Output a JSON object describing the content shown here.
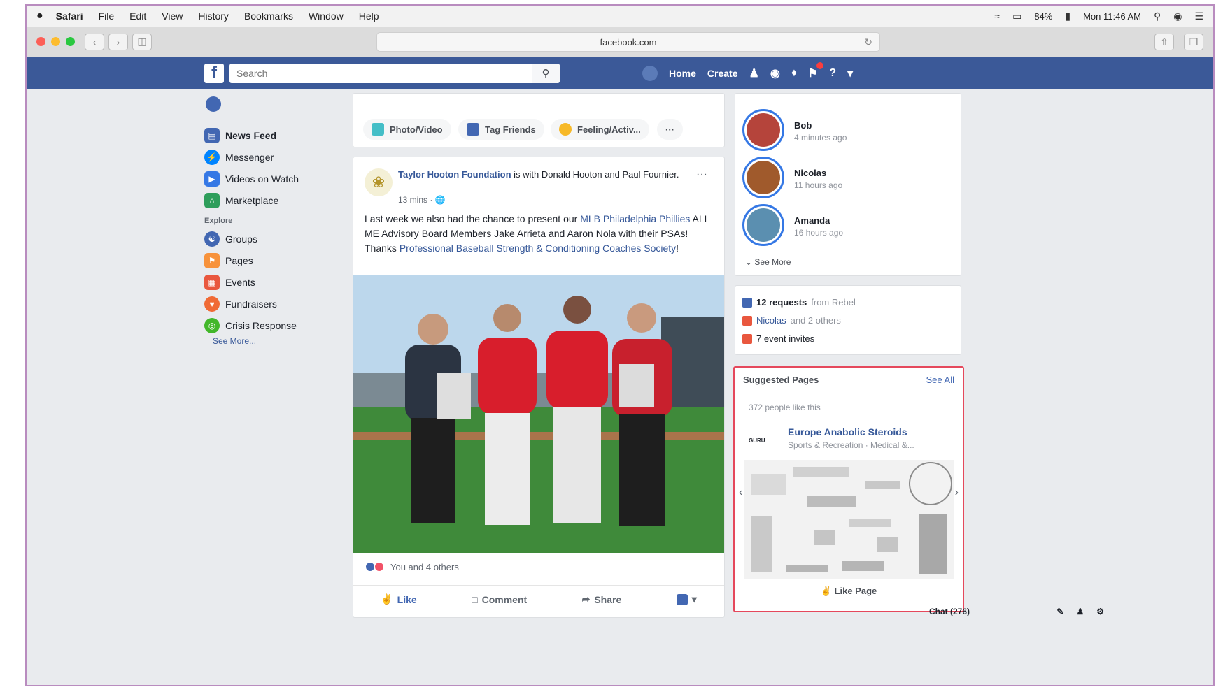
{
  "menubar": {
    "app": "Safari",
    "items": [
      "File",
      "Edit",
      "View",
      "History",
      "Bookmarks",
      "Window",
      "Help"
    ],
    "battery": "84%",
    "clock": "Mon 11:46 AM"
  },
  "browser": {
    "url": "facebook.com"
  },
  "fb": {
    "logo": "f",
    "search_placeholder": "Search",
    "nav_home": "Home",
    "nav_create": "Create"
  },
  "sidebar": {
    "items": [
      {
        "label": "News Feed",
        "icon": "news-feed-icon",
        "color": "#4267b2"
      },
      {
        "label": "Messenger",
        "icon": "messenger-icon",
        "color": "#0084ff"
      },
      {
        "label": "Videos on Watch",
        "icon": "watch-icon",
        "color": "#3578e5"
      },
      {
        "label": "Marketplace",
        "icon": "marketplace-icon",
        "color": "#2e9e5b"
      }
    ],
    "explore_header": "Explore",
    "explore": [
      {
        "label": "Groups",
        "icon": "groups-icon",
        "color": "#4267b2"
      },
      {
        "label": "Pages",
        "icon": "pages-icon",
        "color": "#f7923b"
      },
      {
        "label": "Events",
        "icon": "events-icon",
        "color": "#e9573e"
      },
      {
        "label": "Fundraisers",
        "icon": "fundraisers-icon",
        "color": "#f06a35"
      },
      {
        "label": "Crisis Response",
        "icon": "crisis-icon",
        "color": "#42b72a"
      }
    ],
    "see_more": "See More..."
  },
  "composer": {
    "photo_video": "Photo/Video",
    "tag_friends": "Tag Friends",
    "feeling": "Feeling/Activ...",
    "more": "···"
  },
  "post": {
    "author": "Taylor Hooton Foundation",
    "with_text": "is with Donald Hooton and Paul Fournier.",
    "time": "13 mins",
    "text_plain_1": "Last week we also had the chance to present our ",
    "text_link_1": "MLB Philadelphia Phillies",
    "text_plain_2": " ALL ME Advisory Board Members Jake Arrieta and Aaron Nola with their PSAs! Thanks ",
    "text_link_2": "Professional Baseball Strength & Conditioning Coaches Society",
    "text_plain_3": "!",
    "reactions": "You and 4 others",
    "like": "Like",
    "comment": "Comment",
    "share": "Share"
  },
  "stories": [
    {
      "name": "Bob",
      "time": "4 minutes ago",
      "color": "#b5443b"
    },
    {
      "name": "Nicolas",
      "time": "11 hours ago",
      "color": "#a05a2c"
    },
    {
      "name": "Amanda",
      "time": "16 hours ago",
      "color": "#5b8fb0"
    }
  ],
  "stories_see_more": "See More",
  "requests": {
    "friend_count": "12 requests",
    "friend_from": "from Rebel",
    "birthday_name": "Nicolas",
    "birthday_others": "and 2 others",
    "events": "7 event invites"
  },
  "suggested": {
    "title": "Suggested Pages",
    "see_all": "See All",
    "likes": "372 people like this",
    "page_logo": "GURU",
    "page_name": "Europe Anabolic Steroids",
    "page_category": "Sports & Recreation · Medical &...",
    "like_page": "Like Page"
  },
  "chat": {
    "label": "Chat (276)"
  }
}
